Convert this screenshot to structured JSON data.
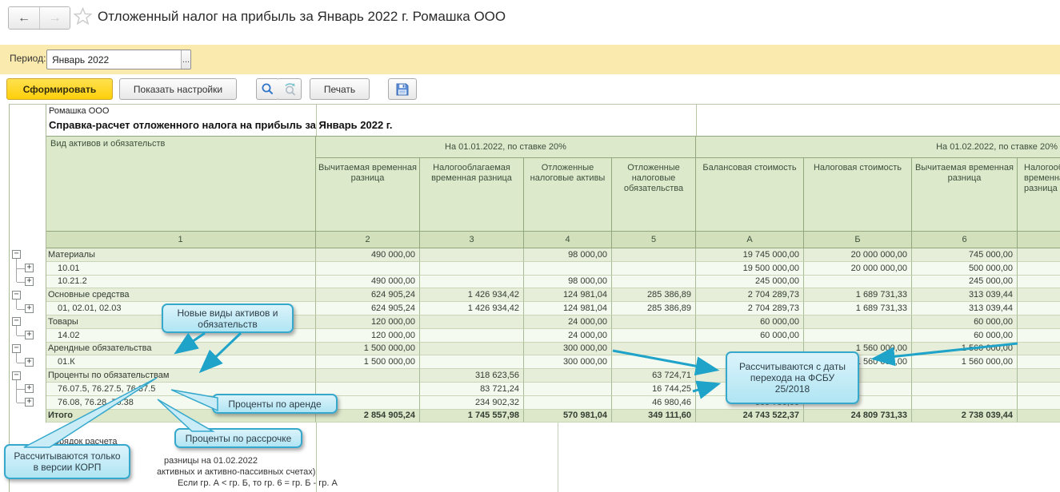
{
  "window": {
    "title": "Отложенный налог на прибыль за Январь 2022 г. Ромашка ООО",
    "nav": {
      "back": "←",
      "forward": "→"
    }
  },
  "period": {
    "label": "Период:",
    "value": "Январь 2022",
    "more": "..."
  },
  "toolbar": {
    "generate": "Сформировать",
    "settings": "Показать настройки",
    "print": "Печать"
  },
  "report": {
    "company": "Ромашка ООО",
    "title": "Справка-расчет отложенного налога на прибыль за Январь 2022 г.",
    "group_headers": [
      "На 01.01.2022, по ставке 20%",
      "На 01.02.2022, по ставке 20%"
    ],
    "columns": [
      {
        "id": "c1",
        "num": "1",
        "title": "Вид активов и обязательств"
      },
      {
        "id": "c2",
        "num": "2",
        "title": "Вычитаемая временная разница"
      },
      {
        "id": "c3",
        "num": "3",
        "title": "Налогооблагаемая временная разница"
      },
      {
        "id": "c4",
        "num": "4",
        "title": "Отложенные налоговые активы"
      },
      {
        "id": "c5",
        "num": "5",
        "title": "Отложенные налоговые обязательства"
      },
      {
        "id": "cA",
        "num": "А",
        "title": "Балансовая стоимость"
      },
      {
        "id": "cB",
        "num": "Б",
        "title": "Налоговая стоимость"
      },
      {
        "id": "c6",
        "num": "6",
        "title": "Вычитаемая временная разница"
      },
      {
        "id": "c7",
        "num": "",
        "title": "Налогооблагаемая временная разница"
      }
    ],
    "rows": [
      {
        "label": "Материалы",
        "type": "group",
        "c2": "490 000,00",
        "c4": "98 000,00",
        "cA": "19 745 000,00",
        "cB": "20 000 000,00",
        "c6": "745 000,00"
      },
      {
        "label": "10.01",
        "type": "child",
        "cA": "19 500 000,00",
        "cB": "20 000 000,00",
        "c6": "500 000,00"
      },
      {
        "label": "10.21.2",
        "type": "child",
        "c2": "490 000,00",
        "c4": "98 000,00",
        "cA": "245 000,00",
        "c6": "245 000,00"
      },
      {
        "label": "Основные средства",
        "type": "group",
        "c2": "624 905,24",
        "c3": "1 426 934,42",
        "c4": "124 981,04",
        "c5": "285 386,89",
        "cA": "2 704 289,73",
        "cB": "1 689 731,33",
        "c6": "313 039,44"
      },
      {
        "label": "01, 02.01, 02.03",
        "type": "child",
        "c2": "624 905,24",
        "c3": "1 426 934,42",
        "c4": "124 981,04",
        "c5": "285 386,89",
        "cA": "2 704 289,73",
        "cB": "1 689 731,33",
        "c6": "313 039,44"
      },
      {
        "label": "Товары",
        "type": "group",
        "c2": "120 000,00",
        "c4": "24 000,00",
        "cA": "60 000,00",
        "c6": "60 000,00"
      },
      {
        "label": "14.02",
        "type": "child",
        "c2": "120 000,00",
        "c4": "24 000,00",
        "cA": "60 000,00",
        "c6": "60 000,00"
      },
      {
        "label": "Арендные обязательства",
        "type": "group",
        "c2": "1 500 000,00",
        "c4": "300 000,00",
        "cB": "1 560 000,00",
        "c6": "1 560 000,00"
      },
      {
        "label": "01.К",
        "type": "child",
        "c2": "1 500 000,00",
        "c4": "300 000,00",
        "cB": "1 560 000,00",
        "c6": "1 560 000,00"
      },
      {
        "label": "Проценты по обязательствам",
        "type": "group",
        "c3": "318 623,56",
        "c5": "63 724,71"
      },
      {
        "label": "76.07.5, 76.27.5, 76.37.5",
        "type": "child",
        "c3": "83 721,24",
        "c5": "16 744,25"
      },
      {
        "label": "76.08, 76.28, 76.38",
        "type": "child",
        "c3": "234 902,32",
        "c5": "46 980,46",
        "cA": "509 750,60"
      },
      {
        "label": "Итого",
        "type": "total",
        "c2": "2 854 905,24",
        "c3": "1 745 557,98",
        "c4": "570 981,04",
        "c5": "349 111,60",
        "cA": "24 743 522,37",
        "cB": "24 809 731,33",
        "c6": "2 738 039,44"
      }
    ],
    "footer_fragments": [
      "Порядок расчета",
      "разницы на 01.02.2022",
      "активных и активно-пассивных счетах)",
      "Если гр. А < гр. Б, то гр. 6 = гр. Б - гр. А"
    ]
  },
  "callouts": [
    {
      "id": "new-types",
      "text": "Новые виды активов и обязательств"
    },
    {
      "id": "fsbu",
      "text": "Рассчитываются с даты перехода на ФСБУ 25/2018"
    },
    {
      "id": "rent",
      "text": "Проценты по аренде"
    },
    {
      "id": "installment",
      "text": "Проценты по рассрочке"
    },
    {
      "id": "korp",
      "text": "Рассчитываются только в версии КОРП"
    }
  ],
  "colors": {
    "accent_yellow": "#fecf0a",
    "period_bar": "#fbeaae",
    "header_green": "#dce9ca",
    "group_row": "#e6edd9",
    "child_row": "#f5faf0",
    "total_row": "#dce8c9",
    "callout_border": "#35a8cc",
    "callout_fill": "#c9ecf7",
    "arrow": "#1fa3c9"
  }
}
